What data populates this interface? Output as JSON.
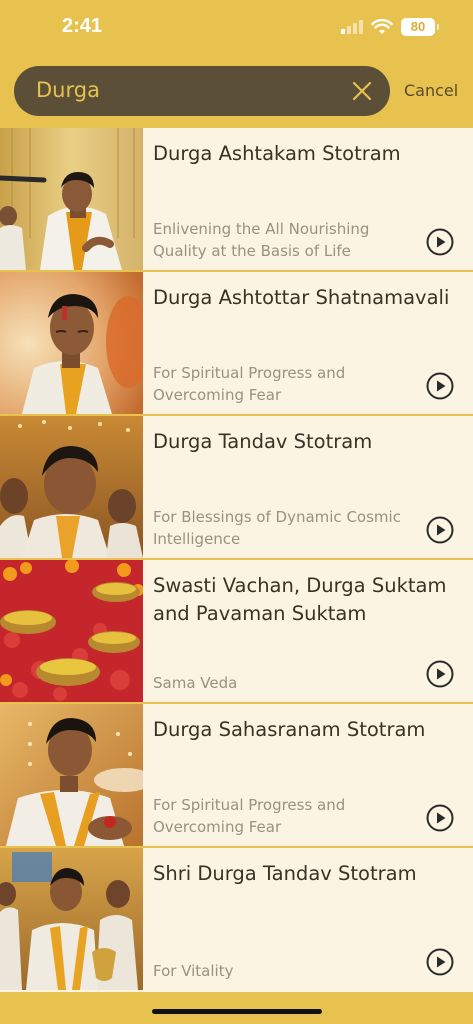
{
  "status": {
    "time": "2:41",
    "battery": "80"
  },
  "search": {
    "query": "Durga",
    "cancel_label": "Cancel"
  },
  "colors": {
    "accent": "#e8c24f",
    "search_bg": "#5c4f38",
    "row_bg": "#fcf4e2",
    "title": "#3a3226",
    "subtitle": "#9a917f"
  },
  "results": [
    {
      "title": "Durga Ashtakam Stotram",
      "subtitle": "Enlivening the All Nourishing Quality at the Basis of Life",
      "thumb_icon": "singer-with-microphone-photo"
    },
    {
      "title": "Durga Ashtottar Shatnamavali",
      "subtitle": "For Spiritual Progress and Overcoming Fear",
      "thumb_icon": "chanting-man-photo"
    },
    {
      "title": "Durga Tandav Stotram",
      "subtitle": "For Blessings of Dynamic Cosmic Intelligence",
      "thumb_icon": "chanting-group-photo"
    },
    {
      "title": "Swasti Vachan, Durga Suktam and Pavaman Suktam",
      "subtitle": "Sama Veda",
      "thumb_icon": "oil-lamps-and-flowers-photo"
    },
    {
      "title": "Durga Sahasranam Stotram",
      "subtitle": "For Spiritual Progress and Overcoming Fear",
      "thumb_icon": "offering-man-photo"
    },
    {
      "title": "Shri Durga Tandav Stotram",
      "subtitle": "For Vitality",
      "thumb_icon": "priests-group-photo"
    }
  ]
}
